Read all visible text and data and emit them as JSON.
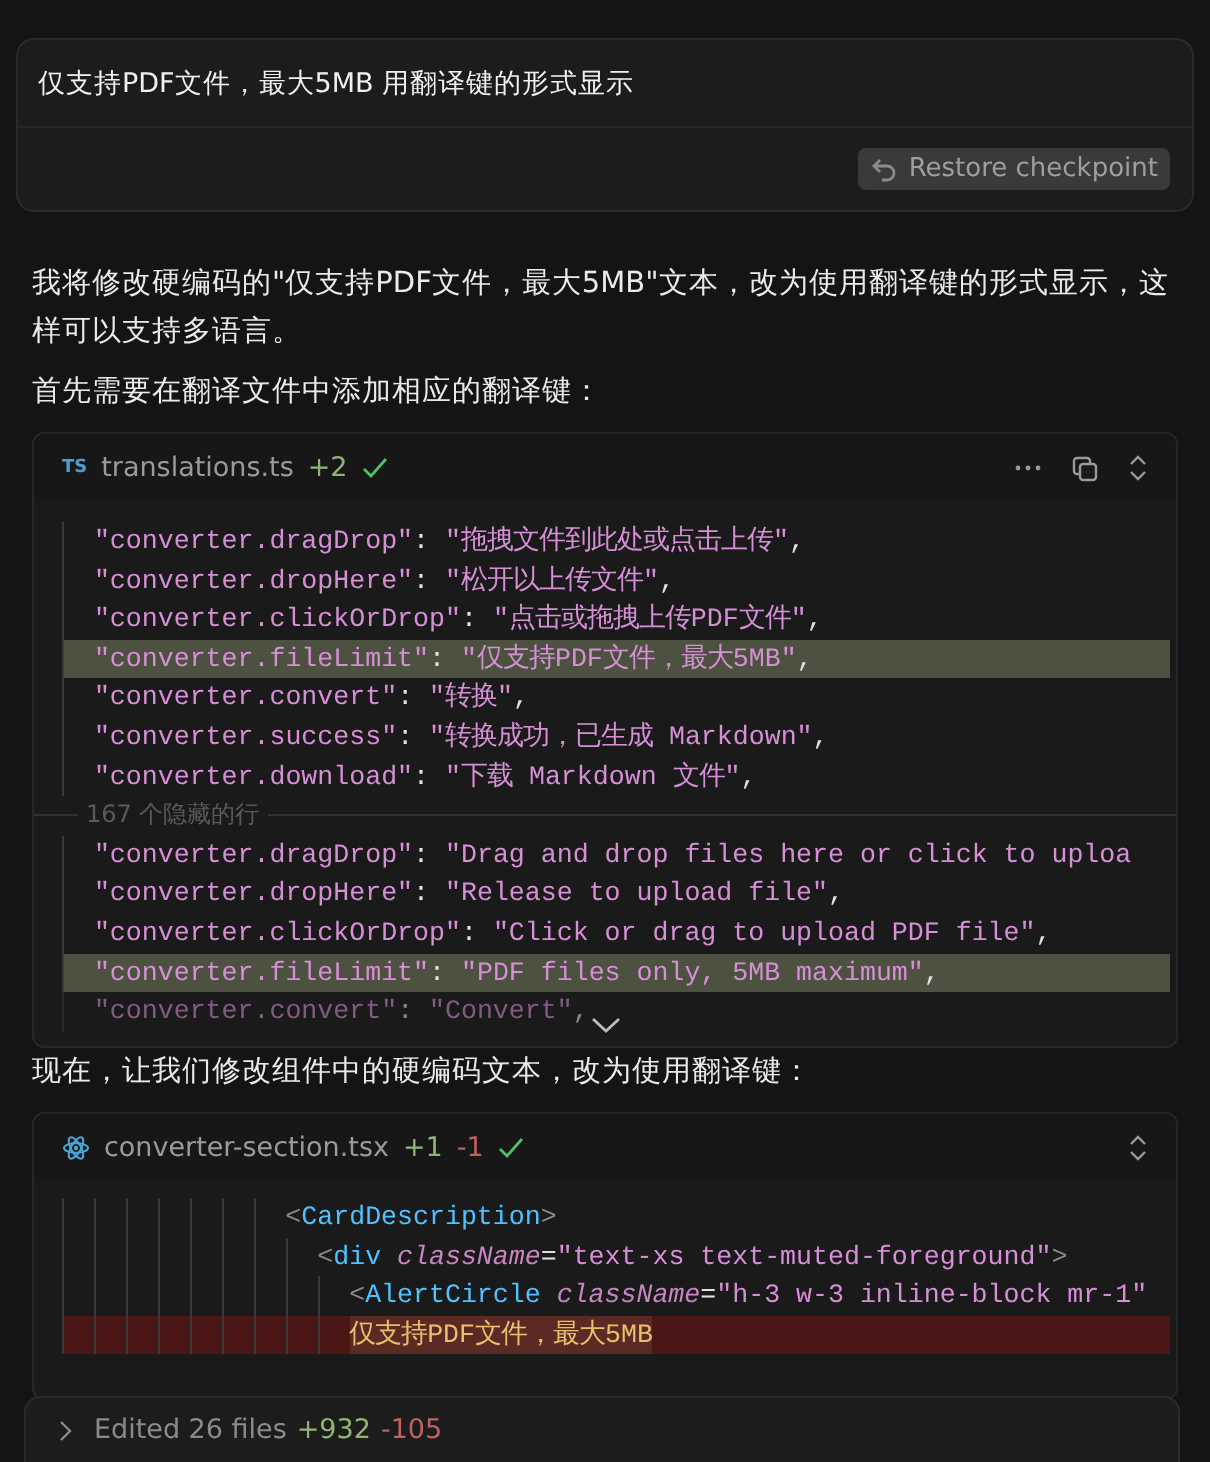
{
  "user_message": {
    "text": "仅支持PDF文件，最大5MB 用翻译键的形式显示",
    "restore_button": "Restore checkpoint"
  },
  "paragraphs": [
    "我将修改硬编码的\"仅支持PDF文件，最大5MB\"文本，改为使用翻译键的形式显示，这样可以支持多语言。",
    "首先需要在翻译文件中添加相应的翻译键："
  ],
  "code_block_1": {
    "file_icon": "TS",
    "filename": "translations.ts",
    "added": "+2",
    "applied": true,
    "lines": [
      {
        "kind": "plain",
        "segs": [
          {
            "kind": "str",
            "t": "  \"converter.dragDrop\""
          },
          {
            "kind": "punct",
            "t": ":"
          },
          {
            "kind": "str",
            "t": "\"拖拽文件到此处或点击上传\""
          },
          {
            "kind": "punct",
            "t": ","
          }
        ]
      },
      {
        "kind": "plain",
        "segs": [
          {
            "kind": "str",
            "t": "  \"converter.dropHere\""
          },
          {
            "kind": "punct",
            "t": ":"
          },
          {
            "kind": "str",
            "t": "\"松开以上传文件\""
          },
          {
            "kind": "punct",
            "t": ","
          }
        ]
      },
      {
        "kind": "plain",
        "segs": [
          {
            "kind": "str",
            "t": "  \"converter.clickOrDrop\""
          },
          {
            "kind": "punct",
            "t": ":"
          },
          {
            "kind": "str",
            "t": "\"点击或拖拽上传PDF文件\""
          },
          {
            "kind": "punct",
            "t": ","
          }
        ]
      },
      {
        "kind": "changed",
        "segs": [
          {
            "kind": "str",
            "t": "  \"converter.fileLimit\""
          },
          {
            "kind": "punct",
            "t": ":"
          },
          {
            "kind": "str",
            "t": "\"仅支持PDF文件，最大5MB\""
          },
          {
            "kind": "punct",
            "t": ","
          }
        ]
      },
      {
        "kind": "plain",
        "segs": [
          {
            "kind": "str",
            "t": "  \"converter.convert\""
          },
          {
            "kind": "punct",
            "t": ":"
          },
          {
            "kind": "str",
            "t": "\"转换\""
          },
          {
            "kind": "punct",
            "t": ","
          }
        ]
      },
      {
        "kind": "plain",
        "segs": [
          {
            "kind": "str",
            "t": "  \"converter.success\""
          },
          {
            "kind": "punct",
            "t": ":"
          },
          {
            "kind": "str",
            "t": "\"转换成功，已生成 Markdown\""
          },
          {
            "kind": "punct",
            "t": ","
          }
        ]
      },
      {
        "kind": "plain",
        "segs": [
          {
            "kind": "str",
            "t": "  \"converter.download\""
          },
          {
            "kind": "punct",
            "t": ":"
          },
          {
            "kind": "str",
            "t": "\"下载 Markdown 文件\""
          },
          {
            "kind": "punct",
            "t": ","
          }
        ]
      },
      {
        "kind": "fold",
        "text": "167 个隐藏的行"
      },
      {
        "kind": "plain",
        "segs": [
          {
            "kind": "str",
            "t": "  \"converter.dragDrop\""
          },
          {
            "kind": "punct",
            "t": ":"
          },
          {
            "kind": "str",
            "t": "\"Drag and drop files here or click to uploa"
          }
        ]
      },
      {
        "kind": "plain",
        "segs": [
          {
            "kind": "str",
            "t": "  \"converter.dropHere\""
          },
          {
            "kind": "punct",
            "t": ":"
          },
          {
            "kind": "str",
            "t": "\"Release to upload file\""
          },
          {
            "kind": "punct",
            "t": ","
          }
        ]
      },
      {
        "kind": "plain",
        "segs": [
          {
            "kind": "str",
            "t": "  \"converter.clickOrDrop\""
          },
          {
            "kind": "punct",
            "t": ":"
          },
          {
            "kind": "str",
            "t": "\"Click or drag to upload PDF file\""
          },
          {
            "kind": "punct",
            "t": ","
          }
        ]
      },
      {
        "kind": "changed",
        "segs": [
          {
            "kind": "str",
            "t": "  \"converter.fileLimit\""
          },
          {
            "kind": "punct",
            "t": ":"
          },
          {
            "kind": "str",
            "t": "\"PDF files only, 5MB maximum\""
          },
          {
            "kind": "punct",
            "t": ","
          }
        ]
      },
      {
        "kind": "faded",
        "segs": [
          {
            "kind": "str",
            "t": "  \"converter.convert\""
          },
          {
            "kind": "punct",
            "t": ":"
          },
          {
            "kind": "str",
            "t": "\"Convert\""
          },
          {
            "kind": "punct",
            "t": ","
          }
        ]
      }
    ]
  },
  "paragraph_2": "现在，让我们修改组件中的硬编码文本，改为使用翻译键：",
  "code_block_2": {
    "filename": "converter-section.tsx",
    "added": "+1",
    "removed": "-1",
    "applied": true,
    "lines": [
      {
        "kind": "plain",
        "segs": [
          {
            "kind": "br",
            "t": "              <"
          },
          {
            "kind": "tag",
            "t": "CardDescription"
          },
          {
            "kind": "br",
            "t": ">"
          }
        ]
      },
      {
        "kind": "plain",
        "segs": [
          {
            "kind": "br",
            "t": "                <"
          },
          {
            "kind": "tag",
            "t": "div"
          },
          {
            "kind": "attr",
            "t": "className"
          },
          {
            "kind": "punct",
            "t": "="
          },
          {
            "kind": "str",
            "t": "\"text-xs text-muted-foreground\""
          },
          {
            "kind": "br",
            "t": ">"
          }
        ]
      },
      {
        "kind": "plain",
        "segs": [
          {
            "kind": "br",
            "t": "                  <"
          },
          {
            "kind": "tag",
            "t": "AlertCircle"
          },
          {
            "kind": "attr",
            "t": "className"
          },
          {
            "kind": "punct",
            "t": "="
          },
          {
            "kind": "str",
            "t": "\"h-3 w-3 inline-block mr-1\""
          }
        ]
      },
      {
        "kind": "deleted",
        "segs": [
          {
            "kind": "del",
            "t": "                  仅支持PDF文件，最大5MB"
          }
        ]
      }
    ]
  },
  "footer": {
    "expanded": false,
    "label": "Edited 26 files",
    "added": "+932",
    "removed": "-105"
  }
}
